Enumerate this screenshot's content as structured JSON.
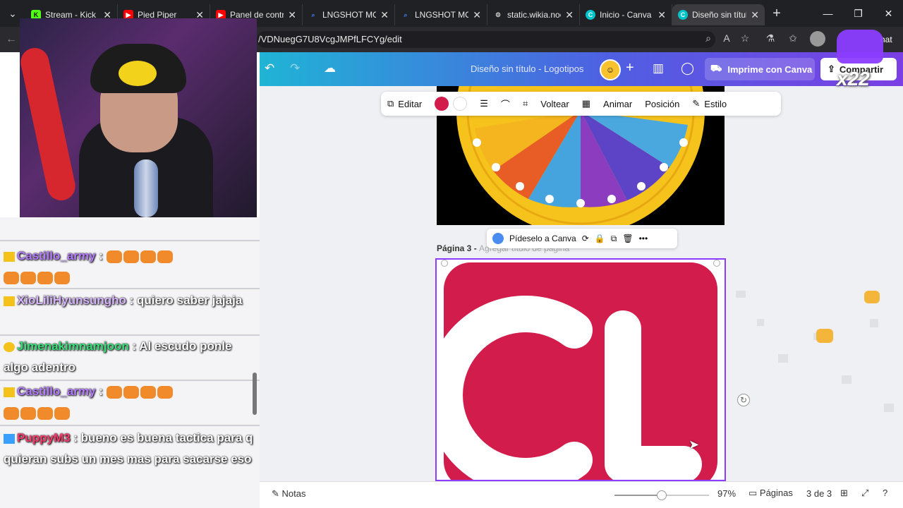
{
  "browser": {
    "tabs": [
      {
        "title": "Stream - Kick D",
        "favicon_color": "#53fc18",
        "favicon_letter": "K"
      },
      {
        "title": "Pied Piper",
        "favicon_color": "#ff0000",
        "favicon_letter": "▶"
      },
      {
        "title": "Panel de contro",
        "favicon_color": "#ff0000",
        "favicon_letter": "▶"
      },
      {
        "title": "LNGSHOT MOC",
        "favicon_color": "#3b82f6",
        "favicon_letter": "🔍"
      },
      {
        "title": "LNGSHOT MOC",
        "favicon_color": "#3b82f6",
        "favicon_letter": "🔍"
      },
      {
        "title": "static.wikia.noc",
        "favicon_color": "#777",
        "favicon_letter": "⚙"
      },
      {
        "title": "Inicio - Canva",
        "favicon_color": "#00c4cc",
        "favicon_letter": "C"
      },
      {
        "title": "Diseño sin títul",
        "favicon_color": "#00c4cc",
        "favicon_letter": "C"
      }
    ],
    "url": "/VDNuegG7U8VcgJMPfLFCYg/edit",
    "right_label": "hat"
  },
  "canva": {
    "doc_title": "Diseño sin título - Logotipos",
    "print_label": "Imprime con Canva",
    "share_label": "Compartir",
    "toolbar": {
      "edit": "Editar",
      "flip": "Voltear",
      "animate": "Animar",
      "position": "Posición",
      "style": "Estilo",
      "color": "#d21c4b"
    },
    "page_actions": {
      "ask": "Pídeselo a Canva"
    },
    "page3": {
      "label": "Página 3 - ",
      "title_placeholder": "Agregar título de página",
      "logo_text": "CL",
      "bg": "#d21c4b"
    },
    "footer": {
      "notes": "Notas",
      "zoom": "97%",
      "pages_label": "Páginas",
      "pages_count": "3 de 3",
      "zoom_fraction": 0.5
    }
  },
  "overlay": {
    "kick_cat_label": "x22"
  },
  "chat": {
    "messages": [
      {
        "user": "Castillo_army",
        "user_color": "#b57bff",
        "text": ""
      },
      {
        "user": "XioLiliHyunsungho",
        "user_color": "#d8b6ff",
        "text": " : quiero saber jajaja"
      },
      {
        "user": "Jimenakimnamjoon",
        "user_color": "#39e07a",
        "text": " : Al escudo ponle algo adentro"
      },
      {
        "user": "Castillo_army",
        "user_color": "#b57bff",
        "text": ""
      },
      {
        "user": "PuppyM3",
        "user_color": "#ff3a6d",
        "text": " : bueno es buena tactica para q quieran subs un mes mas para sacarse eso"
      }
    ]
  }
}
